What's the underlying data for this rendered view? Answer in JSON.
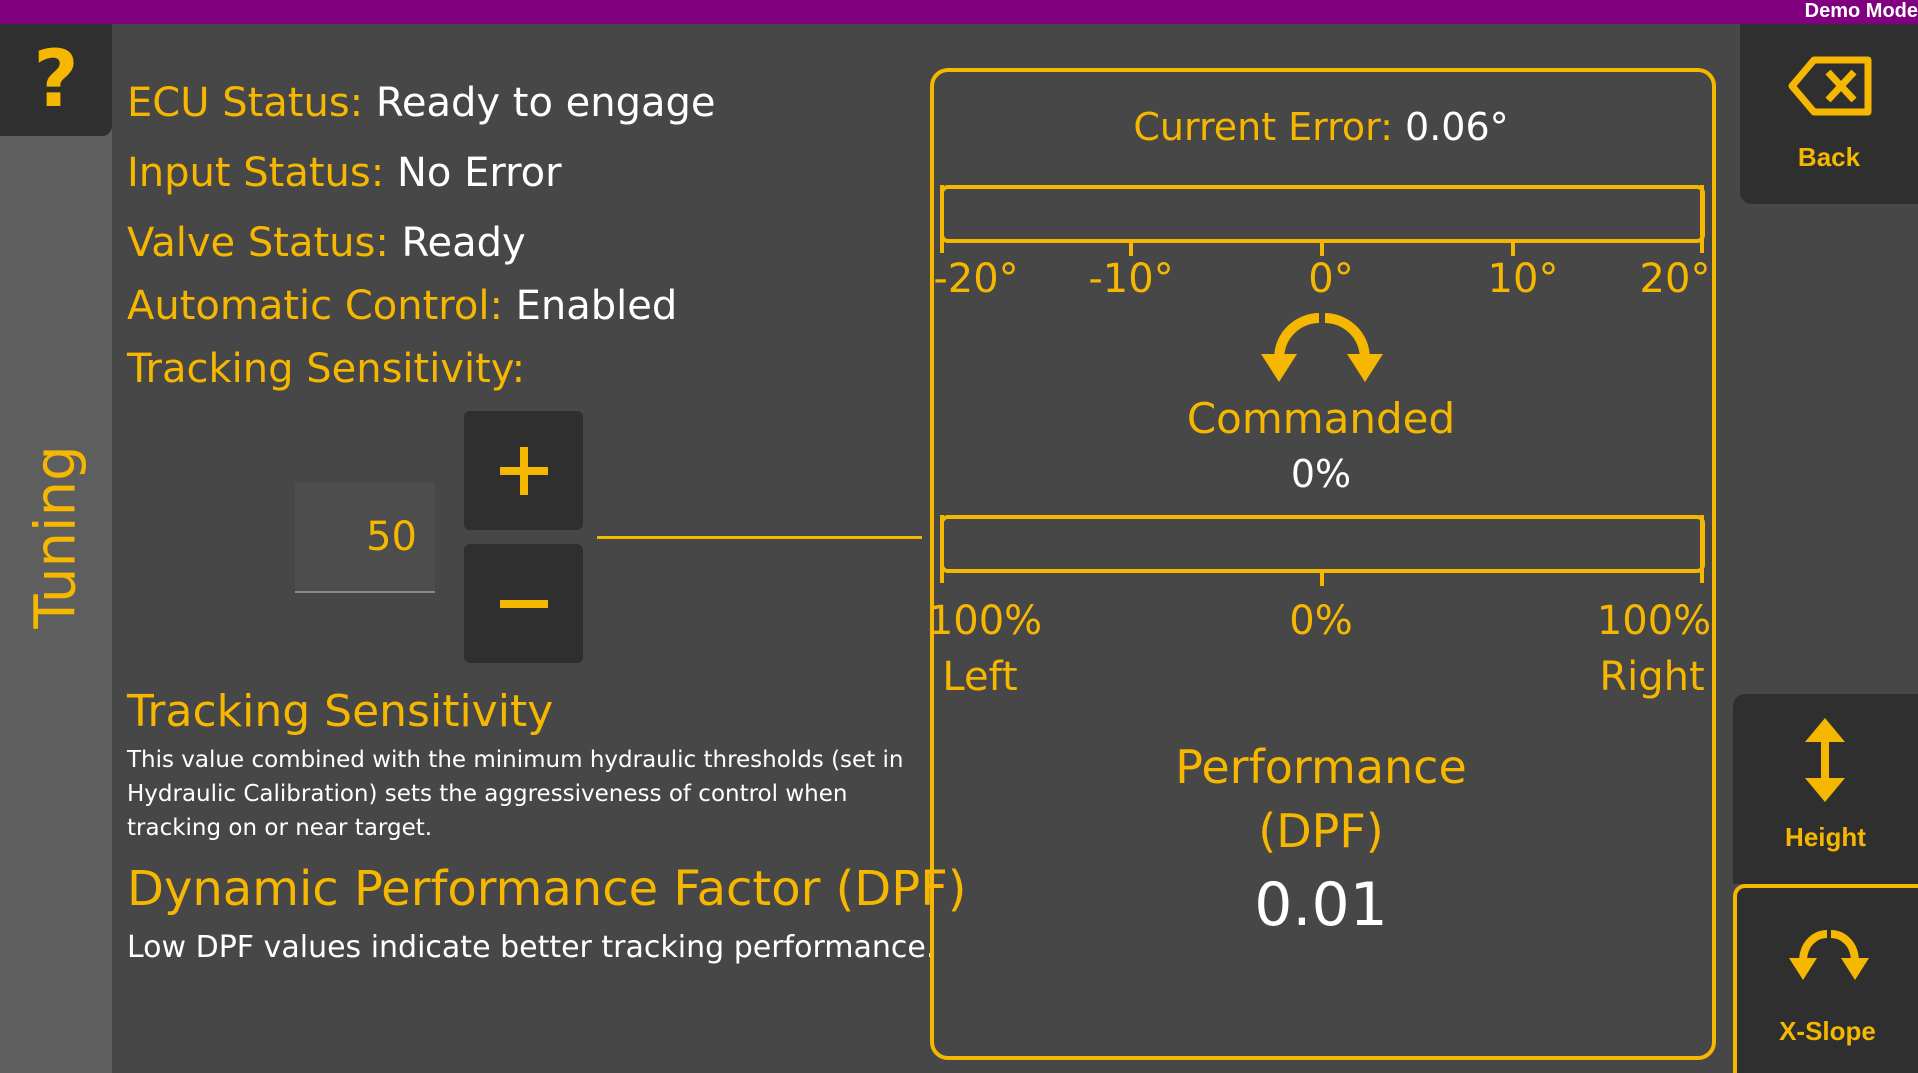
{
  "topbar": {
    "mode_label": "Demo Mode"
  },
  "left": {
    "help_glyph": "?",
    "section_label": "Tuning"
  },
  "status": {
    "ecu": {
      "key": "ECU Status:",
      "value": "Ready to engage"
    },
    "input": {
      "key": "Input Status:",
      "value": "No Error"
    },
    "valve": {
      "key": "Valve Status:",
      "value": "Ready"
    },
    "auto": {
      "key": "Automatic Control:",
      "value": "Enabled"
    },
    "sensitivity_key": "Tracking Sensitivity:"
  },
  "sensitivity": {
    "value": "50",
    "plus_glyph": "+",
    "minus_glyph": "–"
  },
  "help": {
    "ts_title": "Tracking Sensitivity",
    "ts_desc": "This value combined with the minimum hydraulic thresholds (set in Hydraulic Calibration) sets the aggressiveness of control when tracking on or near target.",
    "dpf_title": "Dynamic Performance Factor (DPF)",
    "dpf_desc": "Low DPF values indicate better tracking performance."
  },
  "panel": {
    "error_key": "Current Error:",
    "error_value": "0.06°",
    "error_scale": [
      "-20°",
      "-10°",
      "0°",
      "10°",
      "20°"
    ],
    "commanded_label": "Commanded",
    "commanded_value": "0%",
    "commanded_scale_top": [
      "100%",
      "0%",
      "100%"
    ],
    "commanded_scale_bottom": [
      "Left",
      "Right"
    ],
    "performance_line1": "Performance",
    "performance_line2": "(DPF)",
    "performance_value": "0.01"
  },
  "right": {
    "back_label": "Back",
    "height_label": "Height",
    "xslope_label": "X-Slope"
  },
  "icons": {
    "back": "backspace-x-icon",
    "height": "vertical-arrows-icon",
    "xslope": "rotate-arrows-icon",
    "commanded": "rotate-arrows-icon"
  },
  "colors": {
    "accent": "#f5b700",
    "topbar": "#800080",
    "background": "#474747",
    "button": "#2f2f2f"
  }
}
